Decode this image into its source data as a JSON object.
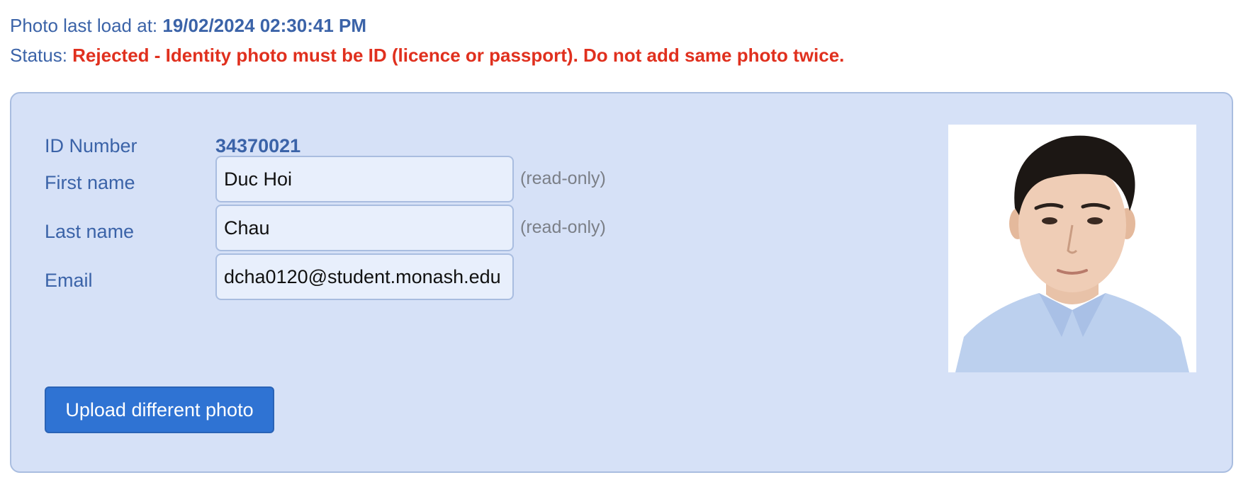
{
  "header": {
    "photo_label": "Photo last load at: ",
    "photo_date": "19/02/2024 02:30:41 PM",
    "status_label": "Status: ",
    "status_text": "Rejected - Identity photo must be ID (licence or passport). Do not add same photo twice."
  },
  "form": {
    "id_label": "ID Number",
    "id_value": "34370021",
    "first_name_label": "First name",
    "first_name_value": "Duc Hoi",
    "last_name_label": "Last name",
    "last_name_value": "Chau",
    "email_label": "Email",
    "email_value": "dcha0120@student.monash.edu",
    "readonly_note": "(read-only)"
  },
  "actions": {
    "upload_label": "Upload different photo"
  },
  "colors": {
    "accent_text": "#3b63a8",
    "status_rejected": "#e0301e",
    "panel_bg": "#d6e1f7",
    "button_bg": "#2f73d3"
  }
}
